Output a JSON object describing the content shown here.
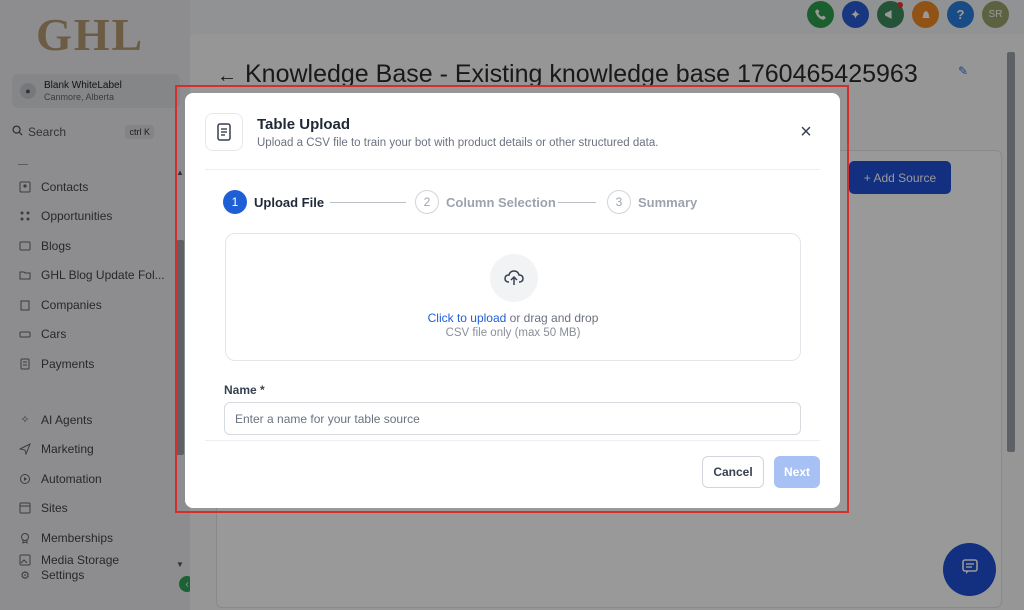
{
  "brand": {
    "logo_text": "GHL",
    "accent": "#1f4fd6"
  },
  "account": {
    "name": "Blank WhiteLabel",
    "location": "Canmore, Alberta"
  },
  "search": {
    "label": "Search",
    "shortcut": "ctrl K"
  },
  "sidebar": {
    "items": [
      {
        "label": "Contacts",
        "icon": "contacts-icon"
      },
      {
        "label": "Opportunities",
        "icon": "opportunities-icon"
      },
      {
        "label": "Blogs",
        "icon": "blogs-icon"
      },
      {
        "label": "GHL Blog Update Fol...",
        "icon": "folder-icon"
      },
      {
        "label": "Companies",
        "icon": "companies-icon"
      },
      {
        "label": "Cars",
        "icon": "cars-icon"
      },
      {
        "label": "Payments",
        "icon": "payments-icon"
      }
    ],
    "items2": [
      {
        "label": "AI Agents",
        "icon": "ai-agents-icon"
      },
      {
        "label": "Marketing",
        "icon": "send-icon"
      },
      {
        "label": "Automation",
        "icon": "automation-icon"
      },
      {
        "label": "Sites",
        "icon": "sites-icon"
      },
      {
        "label": "Memberships",
        "icon": "memberships-icon"
      },
      {
        "label": "Media Storage",
        "icon": "media-icon"
      },
      {
        "label": "Settings",
        "icon": "gear-icon"
      }
    ]
  },
  "topbar": {
    "icons": [
      {
        "name": "phone-icon",
        "color": "#2e9e4f"
      },
      {
        "name": "magic-wand-icon",
        "color": "#2a5bd7"
      },
      {
        "name": "megaphone-icon",
        "color": "#3f8a5c"
      },
      {
        "name": "bell-icon",
        "color": "#f08a24"
      },
      {
        "name": "help-icon",
        "color": "#2a7de1"
      }
    ],
    "avatar_initials": "SR"
  },
  "page": {
    "title": "Knowledge Base - Existing knowledge base 1760465425963",
    "add_source_label": "+ Add Source"
  },
  "modal": {
    "title": "Table Upload",
    "subtitle": "Upload a CSV file to train your bot with product details or other structured data.",
    "close": "×",
    "steps": [
      {
        "num": "1",
        "label": "Upload File",
        "state": "active"
      },
      {
        "num": "2",
        "label": "Column Selection",
        "state": "inactive"
      },
      {
        "num": "3",
        "label": "Summary",
        "state": "inactive"
      }
    ],
    "dropzone": {
      "link_text": "Click to upload",
      "rest_text": " or drag and drop",
      "hint": "CSV file only (max 50 MB)"
    },
    "name_label": "Name *",
    "name_value": "",
    "name_placeholder": "Enter a name for your table source",
    "cancel_label": "Cancel",
    "next_label": "Next"
  }
}
